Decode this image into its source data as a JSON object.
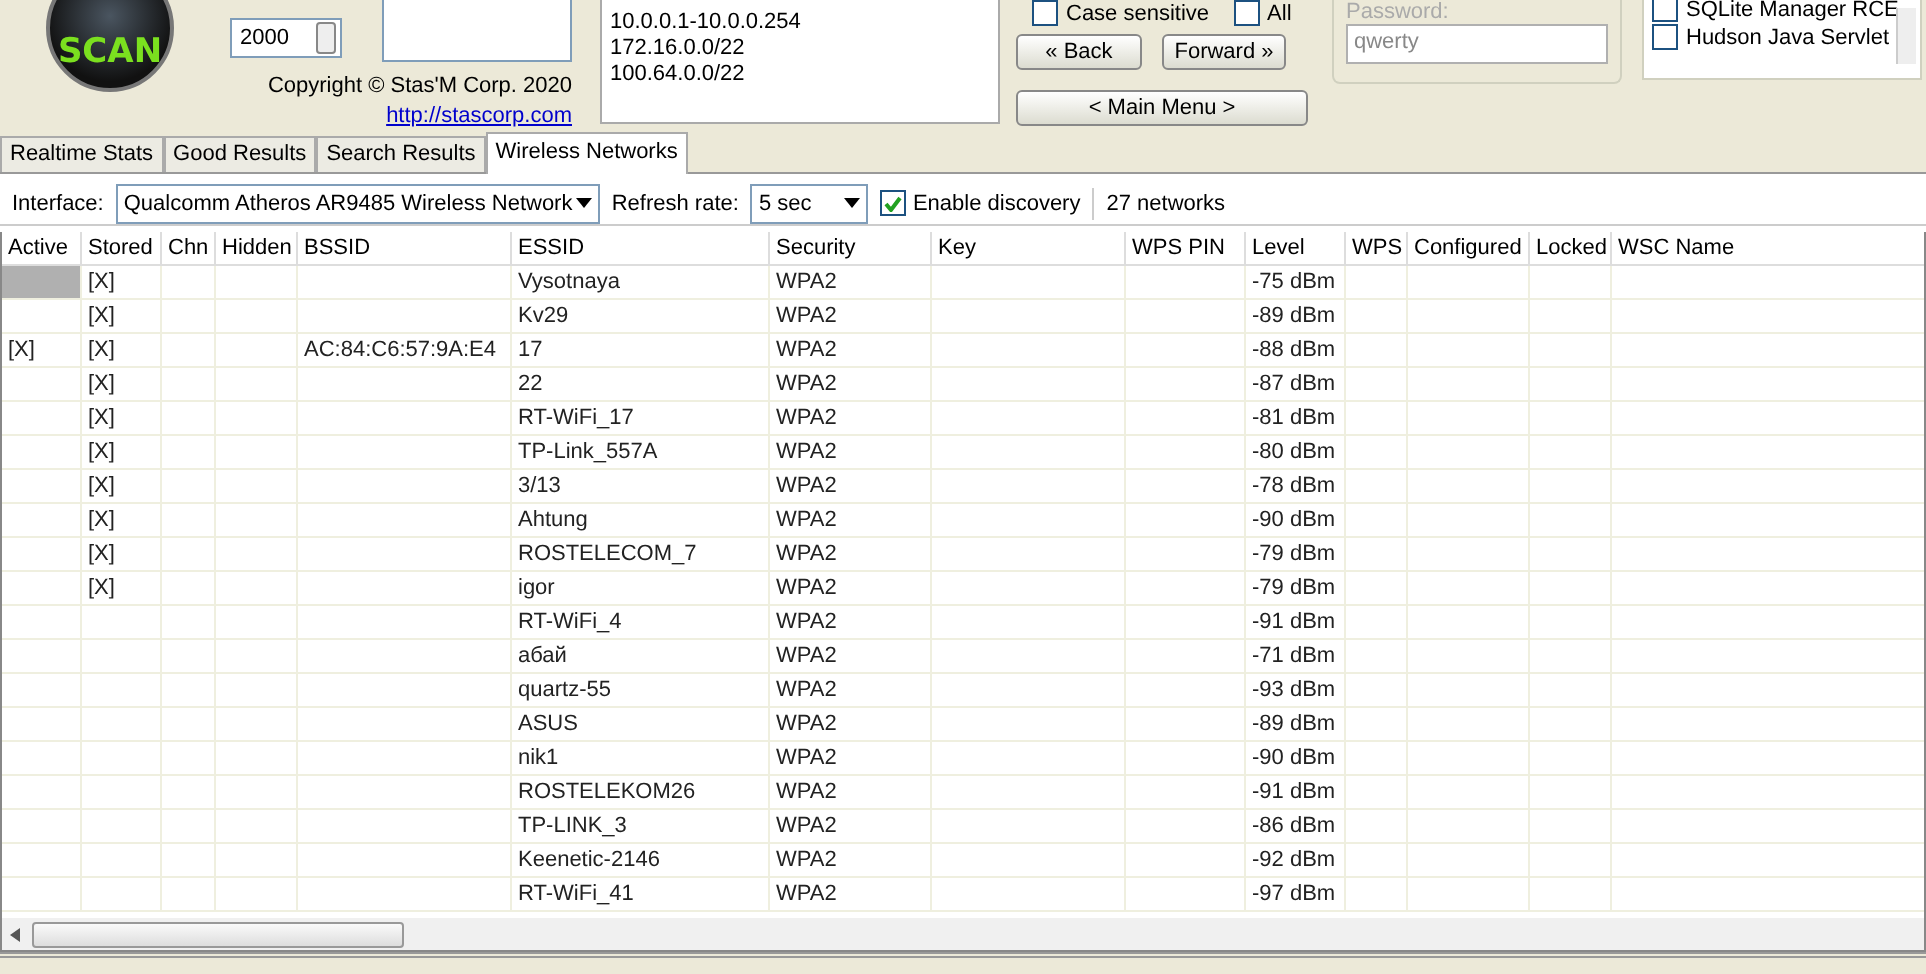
{
  "top": {
    "logo_text": "SCAN",
    "timeout_value": "2000",
    "copyright": "Copyright © Stas'M Corp. 2020",
    "link": "http://stascorp.com",
    "ip_ranges": [
      "10.0.0.1-10.0.0.254",
      "172.16.0.0/22",
      "100.64.0.0/22"
    ],
    "case_sensitive": {
      "label": "Case sensitive",
      "checked": false
    },
    "all": {
      "label": "All",
      "checked": false
    },
    "back": "« Back",
    "forward": "Forward »",
    "main_menu": "< Main Menu >",
    "password": {
      "label": "Password:",
      "value": "qwerty"
    },
    "exploits": [
      {
        "label": "SQLite Manager RCE",
        "checked": false
      },
      {
        "label": "Hudson Java Servlet",
        "checked": false
      }
    ]
  },
  "tabs": [
    {
      "label": "Realtime Stats",
      "selected": false
    },
    {
      "label": "Good Results",
      "selected": false
    },
    {
      "label": "Search Results",
      "selected": false
    },
    {
      "label": "Wireless Networks",
      "selected": true
    }
  ],
  "toolbar": {
    "interface_label": "Interface:",
    "interface": "Qualcomm Atheros AR9485 Wireless Network",
    "refresh_label": "Refresh rate:",
    "refresh": "5 sec",
    "discovery": {
      "label": "Enable discovery",
      "checked": true
    },
    "count": "27 networks"
  },
  "table": {
    "columns": [
      "Active",
      "Stored",
      "Chn",
      "Hidden",
      "BSSID",
      "ESSID",
      "Security",
      "Key",
      "WPS PIN",
      "Level",
      "WPS",
      "Configured",
      "Locked",
      "WSC Name"
    ],
    "rows": [
      {
        "selected": true,
        "cells": [
          "",
          "[X]",
          "",
          "",
          "",
          "Vysotnaya",
          "WPA2",
          "",
          "",
          "-75 dBm",
          "",
          "",
          "",
          ""
        ]
      },
      {
        "selected": false,
        "cells": [
          "",
          "[X]",
          "",
          "",
          "",
          "Kv29",
          "WPA2",
          "",
          "",
          "-89 dBm",
          "",
          "",
          "",
          ""
        ]
      },
      {
        "selected": false,
        "cells": [
          "[X]",
          "[X]",
          "",
          "",
          "AC:84:C6:57:9A:E4",
          "17",
          "WPA2",
          "",
          "",
          "-88 dBm",
          "",
          "",
          "",
          ""
        ]
      },
      {
        "selected": false,
        "cells": [
          "",
          "[X]",
          "",
          "",
          "",
          "22",
          "WPA2",
          "",
          "",
          "-87 dBm",
          "",
          "",
          "",
          ""
        ]
      },
      {
        "selected": false,
        "cells": [
          "",
          "[X]",
          "",
          "",
          "",
          "RT-WiFi_17",
          "WPA2",
          "",
          "",
          "-81 dBm",
          "",
          "",
          "",
          ""
        ]
      },
      {
        "selected": false,
        "cells": [
          "",
          "[X]",
          "",
          "",
          "",
          "TP-Link_557A",
          "WPA2",
          "",
          "",
          "-80 dBm",
          "",
          "",
          "",
          ""
        ]
      },
      {
        "selected": false,
        "cells": [
          "",
          "[X]",
          "",
          "",
          "",
          "3/13",
          "WPA2",
          "",
          "",
          "-78 dBm",
          "",
          "",
          "",
          ""
        ]
      },
      {
        "selected": false,
        "cells": [
          "",
          "[X]",
          "",
          "",
          "",
          "Ahtung",
          "WPA2",
          "",
          "",
          "-90 dBm",
          "",
          "",
          "",
          ""
        ]
      },
      {
        "selected": false,
        "cells": [
          "",
          "[X]",
          "",
          "",
          "",
          "ROSTELECOM_7",
          "WPA2",
          "",
          "",
          "-79 dBm",
          "",
          "",
          "",
          ""
        ]
      },
      {
        "selected": false,
        "cells": [
          "",
          "[X]",
          "",
          "",
          "",
          "igor",
          "WPA2",
          "",
          "",
          "-79 dBm",
          "",
          "",
          "",
          ""
        ]
      },
      {
        "selected": false,
        "cells": [
          "",
          "",
          "",
          "",
          "",
          "RT-WiFi_4",
          "WPA2",
          "",
          "",
          "-91 dBm",
          "",
          "",
          "",
          ""
        ]
      },
      {
        "selected": false,
        "cells": [
          "",
          "",
          "",
          "",
          "",
          "абай",
          "WPA2",
          "",
          "",
          "-71 dBm",
          "",
          "",
          "",
          ""
        ]
      },
      {
        "selected": false,
        "cells": [
          "",
          "",
          "",
          "",
          "",
          "quartz-55",
          "WPA2",
          "",
          "",
          "-93 dBm",
          "",
          "",
          "",
          ""
        ]
      },
      {
        "selected": false,
        "cells": [
          "",
          "",
          "",
          "",
          "",
          "ASUS",
          "WPA2",
          "",
          "",
          "-89 dBm",
          "",
          "",
          "",
          ""
        ]
      },
      {
        "selected": false,
        "cells": [
          "",
          "",
          "",
          "",
          "",
          "nik1",
          "WPA2",
          "",
          "",
          "-90 dBm",
          "",
          "",
          "",
          ""
        ]
      },
      {
        "selected": false,
        "cells": [
          "",
          "",
          "",
          "",
          "",
          "ROSTELEKOM26",
          "WPA2",
          "",
          "",
          "-91 dBm",
          "",
          "",
          "",
          ""
        ]
      },
      {
        "selected": false,
        "cells": [
          "",
          "",
          "",
          "",
          "",
          "TP-LINK_3",
          "WPA2",
          "",
          "",
          "-86 dBm",
          "",
          "",
          "",
          ""
        ]
      },
      {
        "selected": false,
        "cells": [
          "",
          "",
          "",
          "",
          "",
          "Keenetic-2146",
          "WPA2",
          "",
          "",
          "-92 dBm",
          "",
          "",
          "",
          ""
        ]
      },
      {
        "selected": false,
        "cells": [
          "",
          "",
          "",
          "",
          "",
          "RT-WiFi_41",
          "WPA2",
          "",
          "",
          "-97 dBm",
          "",
          "",
          "",
          ""
        ]
      }
    ]
  }
}
